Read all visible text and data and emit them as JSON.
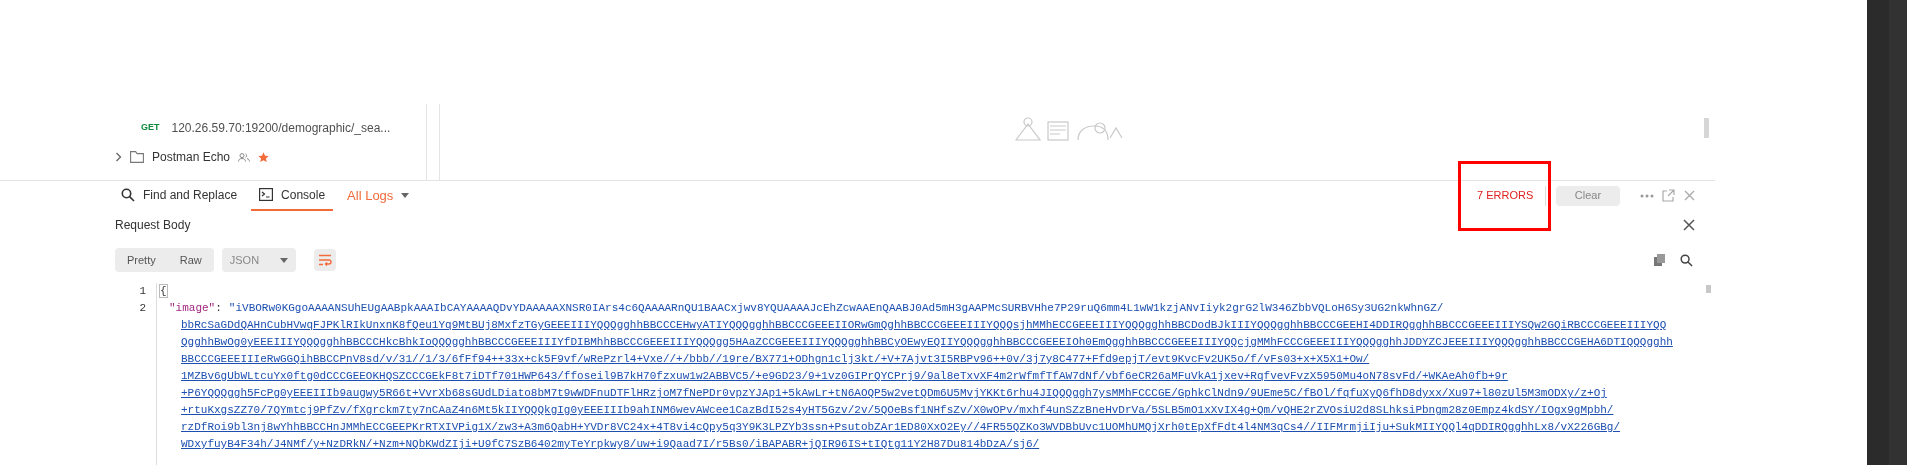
{
  "sidebar": {
    "items": [
      {
        "kind": "request",
        "method": "GET",
        "url": "120.26.59.70:19200/demographic/_sea..."
      },
      {
        "kind": "collection",
        "name": "Postman Echo",
        "favorite": true
      }
    ]
  },
  "console_bar": {
    "tabs": [
      {
        "label": "Find and Replace",
        "kind": "search",
        "selected": false
      },
      {
        "label": "Console",
        "kind": "terminal",
        "selected": true
      }
    ],
    "filter": "All Logs",
    "errors": "7 ERRORS",
    "clear": "Clear"
  },
  "panel": {
    "title": "Request Body",
    "view_modes": [
      "Pretty",
      "Raw"
    ],
    "format": "JSON"
  },
  "code": {
    "lines": [
      {
        "number": "1",
        "text": "{"
      },
      {
        "number": "2",
        "key": "\"image\"",
        "separator": ":",
        "value_lines": [
          "\"iVBORw0KGgoAAAANSUhEUgAABpkAAAIbCAYAAAAQDvYDAAAAAXNSR0IArs4c6QAAAARnQU1BAACxjwv8YQUAAAAJcEhZcwAAEnQAABJ0Ad5mH3gAAPMcSURBVHhe7P29ruQ6mm4L1wW1kzjANvIiyk2grG2lW346ZbbVQLoH6Sy3UG2nkWhnGZ/",
          "bbRcSaGDdQAHnCubHVwqFJPKlRIkUnxnK8fQeu1Yq9MtBUj8MxfzTGyGEEEIIIYQQQgghhBBCCCEHwyATIYQQQgghhBBCCCGEEEIIORwGmQghhBBCCCGEEEIIIYQQQsjhMMhECCGEEEIIIYQQQgghhBBCDodBJkIIIYQQQgghhBBCCCGEEHI4DDIRQgghhBBCCCGEEEIIIYSQw2GQiRBCCCGEEEIIIYQQ",
          "QgghhBwOg0yEEEIIIYQQQgghhBBCCCHkcBhkIoQQQgghhBBCCCGEEEIIIYfDIBMhhBBCCCGEEEIIIYQQQgg5HAaZCCGEEEIIIYQQQgghhBBCyOEwyEQIIYQQQgghhBBCCCGEEEIOh0EmQgghhBBCCCGEEEIIIYQQcjgMMhFCCCGEEEIIIYQQQgghhJDDYZCJEEEIIIYQQQgghhBBCCCGEHA6DTIQQQgghh",
          "BBCCCGEEEIIIeRwGGQihBBCCPnV8sd/v/31//1/3/6fFf94++33x+ck5F9vf/wRePzrl4+Vxe//+/bbb//19re/BX771+ODhgn1clj3kt/+V+7Ajvt3I5RBPv96++0v/3j7y8C477+Ffd9epjT/evt9KvcFv2UK5o/f/vFs03+x+X5X1+Ow/",
          "1MZBv6gUbWLtcuYx0ftg0dCCCGEEOKHQSZCCCGEkF8t7iDTf701HWP643/ffoseil9B7kH70fzxuw1w2ABBVC5/+e9GD23/9+1vz0GIPrQYCPrj9/9al8eTxvXF4m2rWfmfTfAW7dNf/vbf6eCR26aMFuVkA1jxev+RqfvevFvzX5950Mu4oN78svFd/+WKAeAh0fb+9r",
          "+P6YQQQggh5FcPg0yEEEIIIb9augwy5R66t+VvrXb68sGUdLDiato8bM7t9wWDFnuDTFlHRzjoM7fNePDr0vpzYJAp1+5kAwLr+tN6AOQP5w2vetQDm6U5MvjYKKt6rhu4JIQQQggh7ysMMhFCCCGE/GphkClNdn9/9UEme5C/fBOl/fqfuXyQ6fhD8dyxx/Xu97+l80zUl5M3mODXy/z+Oj",
          "+rtuKxgsZZ70/7QYmtcj9PfZv/fXgrckm7ty7nCAaZ4n6Mt5kIIYQQQkgIg0yEEEIIIb9ahINM6wevAWcee1CazBdI52s4yHT5Gzv/2v/5QOeBsf1NHfsZv/X0wOPv/mxhf4unSZzBneHvDrVa/5SLB5mO1xXvIX4g+Qm/vQHE2rZVOsiU2d8SLhksiPbngm28z0Empz4kdSY/IOgx9gMpbh/",
          "rzDfRoi9bl3nj8wYhhBBCCHnJMMhECCGEEPKrRTXIVPig1X/zw3+A3m6QabH+YVDr8VC24x+4T8vi4cQpy5q3Y9K3LPZYb3ssn+PsutobZAr1ED80XxO2Ey//4FR55QZKo3WVDBbUvc1UOMhUMQjXrh0tEpXfFdt4l4NM3qCs4//IIFMrmjiIju+SukMIIYQQl4qDDIRQgghhLx8/vX226GBg/",
          "WDxyfuyB4F34h/J4NMf/y+NzDRkN/+Nzm+NQbKWdZIji+U9fC7SzB6402myTeYrpkwy8/uw+i9Qaad7I/r5Bs0/iBAPABR+jQIR96IS+tIQtg11Y2H87Du814bDzA/sj6/"
        ]
      }
    ]
  }
}
